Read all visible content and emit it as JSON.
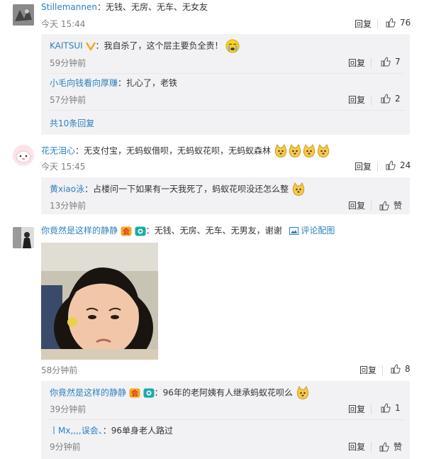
{
  "c1": {
    "name": "Stillemannen",
    "text": "：无钱、无房、无车、无女友",
    "time": "今天 15:44",
    "reply": "回复",
    "likes": "76",
    "subs": [
      {
        "name": "KAITSUI",
        "text": "：我自杀了，这个层主要负全责！",
        "time": "59分钟前",
        "reply": "回复",
        "likes": "7"
      },
      {
        "name": "小毛向钱看向厚赚",
        "text": "：扎心了，老铁",
        "time": "57分钟前",
        "reply": "回复",
        "likes": "2"
      }
    ],
    "more": "共10条回复"
  },
  "c2": {
    "name": "花无泪心",
    "text": "：无支付宝，无蚂蚁借呗，无蚂蚁花呗，无蚂蚁森林",
    "time": "今天 15:45",
    "reply": "回复",
    "likes": "24",
    "subs": [
      {
        "name": "黄xiao泳",
        "text": "：占楼问一下如果有一天我死了，蚂蚁花呗没还怎么整",
        "time": "13分钟前",
        "reply": "回复",
        "likes": "赞"
      }
    ]
  },
  "c3": {
    "name": "你竟然是这样的静静",
    "text": "：无钱、无房、无车、无男友，谢谢",
    "view_pic": "评论配图",
    "time": "58分钟前",
    "reply": "回复",
    "likes": "8",
    "subs": [
      {
        "name": "你竟然是这样的静静",
        "text": "：96年的老阿姨有人继承蚂蚁花呗么",
        "time": "39分钟前",
        "reply": "回复",
        "likes": "1"
      },
      {
        "name": "丨Mx,,,,误会、",
        "text": "：96单身老人路过",
        "time": "9分钟前",
        "reply": "回复",
        "likes": "赞"
      }
    ]
  },
  "colors": {
    "name_blue": "#2e7fc0",
    "gold_v": "#f5a623",
    "subbox_bg": "#f2f2f5"
  }
}
